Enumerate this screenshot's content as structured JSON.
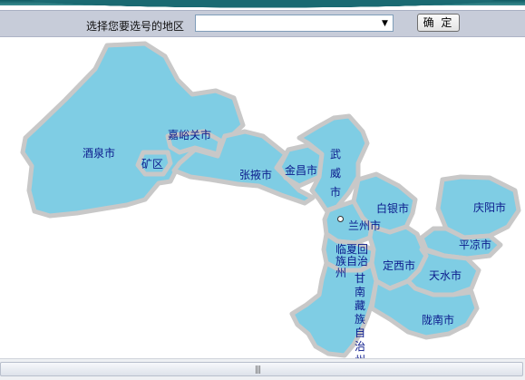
{
  "header": {
    "select_label": "选择您要选号的地区",
    "select_value": "",
    "confirm_label": "确 定"
  },
  "map": {
    "region_fill": "#7fcde4",
    "outline_color": "#c8c8c8",
    "labels": {
      "jiuquan": "酒泉市",
      "jiayuguan": "嘉峪关市",
      "kuangqu": "矿区",
      "zhangye": "张掖市",
      "jinchang": "金昌市",
      "wuwei": "武威市",
      "baiyin": "白银市",
      "lanzhou": "兰州市",
      "qingyang": "庆阳市",
      "pingliang": "平凉市",
      "linxia": "临夏回族自治州",
      "dingxi": "定西市",
      "tianshui": "天水市",
      "gannan": "甘南藏族自治州",
      "longnan": "陇南市"
    }
  },
  "scrollbar": {
    "grip": "|||"
  }
}
